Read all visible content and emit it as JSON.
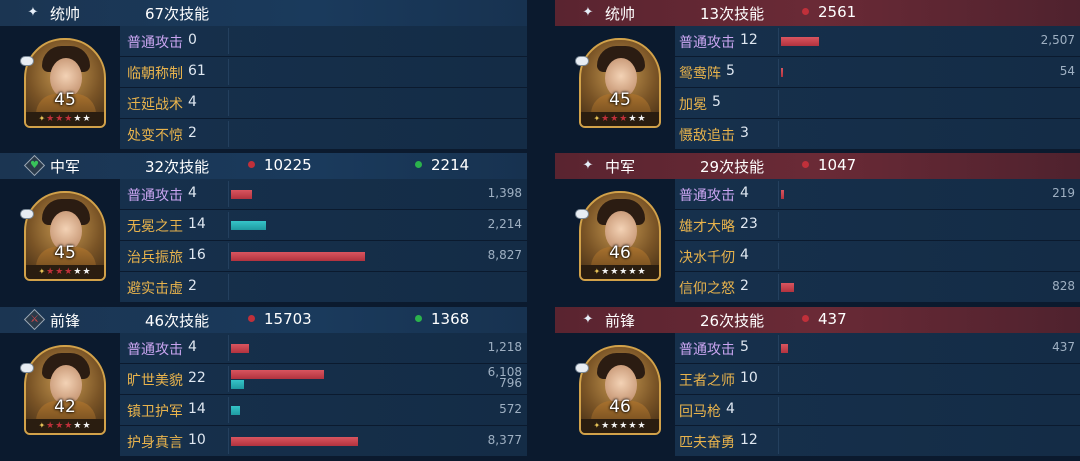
{
  "left": {
    "sections": [
      {
        "role": "统帅",
        "role_icon": "star-icon",
        "skill_count": "67次技能",
        "damage": "",
        "heal": "",
        "level": "45",
        "rows": [
          {
            "skill": "普通攻击",
            "count": "0",
            "normal": true,
            "bars": []
          },
          {
            "skill": "临朝称制",
            "count": "61",
            "normal": false,
            "bars": []
          },
          {
            "skill": "迁延战术",
            "count": "4",
            "normal": false,
            "bars": []
          },
          {
            "skill": "处变不惊",
            "count": "2",
            "normal": false,
            "bars": []
          }
        ]
      },
      {
        "role": "中军",
        "role_icon": "heart-icon",
        "skill_count": "32次技能",
        "damage": "10225",
        "heal": "2214",
        "level": "45",
        "rows": [
          {
            "skill": "普通攻击",
            "count": "4",
            "normal": true,
            "bars": [
              {
                "type": "red",
                "value": "1,398",
                "num": 1398
              }
            ]
          },
          {
            "skill": "无冕之王",
            "count": "14",
            "normal": false,
            "bars": [
              {
                "type": "teal",
                "value": "2,214",
                "num": 2214
              }
            ]
          },
          {
            "skill": "治兵振旅",
            "count": "16",
            "normal": false,
            "bars": [
              {
                "type": "red",
                "value": "8,827",
                "num": 8827
              }
            ]
          },
          {
            "skill": "避实击虚",
            "count": "2",
            "normal": false,
            "bars": []
          }
        ]
      },
      {
        "role": "前锋",
        "role_icon": "sword-icon",
        "skill_count": "46次技能",
        "damage": "15703",
        "heal": "1368",
        "level": "42",
        "rows": [
          {
            "skill": "普通攻击",
            "count": "4",
            "normal": true,
            "bars": [
              {
                "type": "red",
                "value": "1,218",
                "num": 1218
              }
            ]
          },
          {
            "skill": "旷世美貌",
            "count": "22",
            "normal": false,
            "bars": [
              {
                "type": "red",
                "value": "6,108",
                "num": 6108
              },
              {
                "type": "teal",
                "value": "796",
                "num": 796
              }
            ]
          },
          {
            "skill": "镇卫护军",
            "count": "14",
            "normal": false,
            "bars": [
              {
                "type": "teal",
                "value": "572",
                "num": 572
              }
            ]
          },
          {
            "skill": "护身真言",
            "count": "10",
            "normal": false,
            "bars": [
              {
                "type": "red",
                "value": "8,377",
                "num": 8377
              }
            ]
          }
        ]
      }
    ]
  },
  "right": {
    "sections": [
      {
        "role": "统帅",
        "role_icon": "star-icon",
        "skill_count": "13次技能",
        "damage": "2561",
        "heal": "",
        "level": "45",
        "rows": [
          {
            "skill": "普通攻击",
            "count": "12",
            "normal": true,
            "bars": [
              {
                "type": "red",
                "value": "2,507",
                "num": 2507
              }
            ]
          },
          {
            "skill": "鸳鸯阵",
            "count": "5",
            "normal": false,
            "bars": [
              {
                "type": "red",
                "value": "54",
                "num": 54
              }
            ]
          },
          {
            "skill": "加冕",
            "count": "5",
            "normal": false,
            "bars": []
          },
          {
            "skill": "慑敌追击",
            "count": "3",
            "normal": false,
            "bars": []
          }
        ]
      },
      {
        "role": "中军",
        "role_icon": "star-icon",
        "skill_count": "29次技能",
        "damage": "1047",
        "heal": "",
        "level": "46",
        "rows": [
          {
            "skill": "普通攻击",
            "count": "4",
            "normal": true,
            "bars": [
              {
                "type": "red",
                "value": "219",
                "num": 219
              }
            ]
          },
          {
            "skill": "雄才大略",
            "count": "23",
            "normal": false,
            "bars": []
          },
          {
            "skill": "决水千仞",
            "count": "4",
            "normal": false,
            "bars": []
          },
          {
            "skill": "信仰之怒",
            "count": "2",
            "normal": false,
            "bars": [
              {
                "type": "red",
                "value": "828",
                "num": 828
              }
            ]
          }
        ]
      },
      {
        "role": "前锋",
        "role_icon": "star-icon",
        "skill_count": "26次技能",
        "damage": "437",
        "heal": "",
        "level": "46",
        "rows": [
          {
            "skill": "普通攻击",
            "count": "5",
            "normal": true,
            "bars": [
              {
                "type": "red",
                "value": "437",
                "num": 437
              }
            ]
          },
          {
            "skill": "王者之师",
            "count": "10",
            "normal": false,
            "bars": []
          },
          {
            "skill": "回马枪",
            "count": "4",
            "normal": false,
            "bars": []
          },
          {
            "skill": "匹夫奋勇",
            "count": "12",
            "normal": false,
            "bars": []
          }
        ]
      }
    ]
  }
}
